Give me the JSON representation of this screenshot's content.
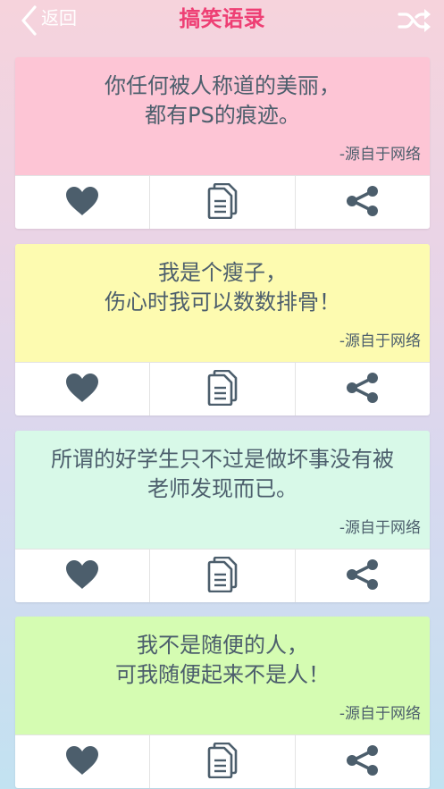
{
  "header": {
    "back_label": "返回",
    "title": "搞笑语录",
    "back_icon": "chevron-left-icon",
    "shuffle_icon": "shuffle-icon"
  },
  "colors": {
    "title": "#ee3f74",
    "text": "#4c5e6c",
    "icon": "#4c5e6c",
    "card_backgrounds": [
      "#fdc5d5",
      "#fdfbb0",
      "#d8f9e8",
      "#d5fcb2"
    ]
  },
  "cards": [
    {
      "line1": "你任何被人称道的美丽，",
      "line2": "都有PS的痕迹。",
      "source": "-源自于网络"
    },
    {
      "line1": "我是个瘦子，",
      "line2": "伤心时我可以数数排骨！",
      "source": "-源自于网络"
    },
    {
      "line1": "所谓的好学生只不过是做坏事没有被",
      "line2": "老师发现而已。",
      "source": "-源自于网络"
    },
    {
      "line1": "我不是随便的人，",
      "line2": "可我随便起来不是人！",
      "source": "-源自于网络"
    }
  ],
  "card_actions": {
    "like_icon": "heart-icon",
    "copy_icon": "copy-document-icon",
    "share_icon": "share-icon"
  }
}
